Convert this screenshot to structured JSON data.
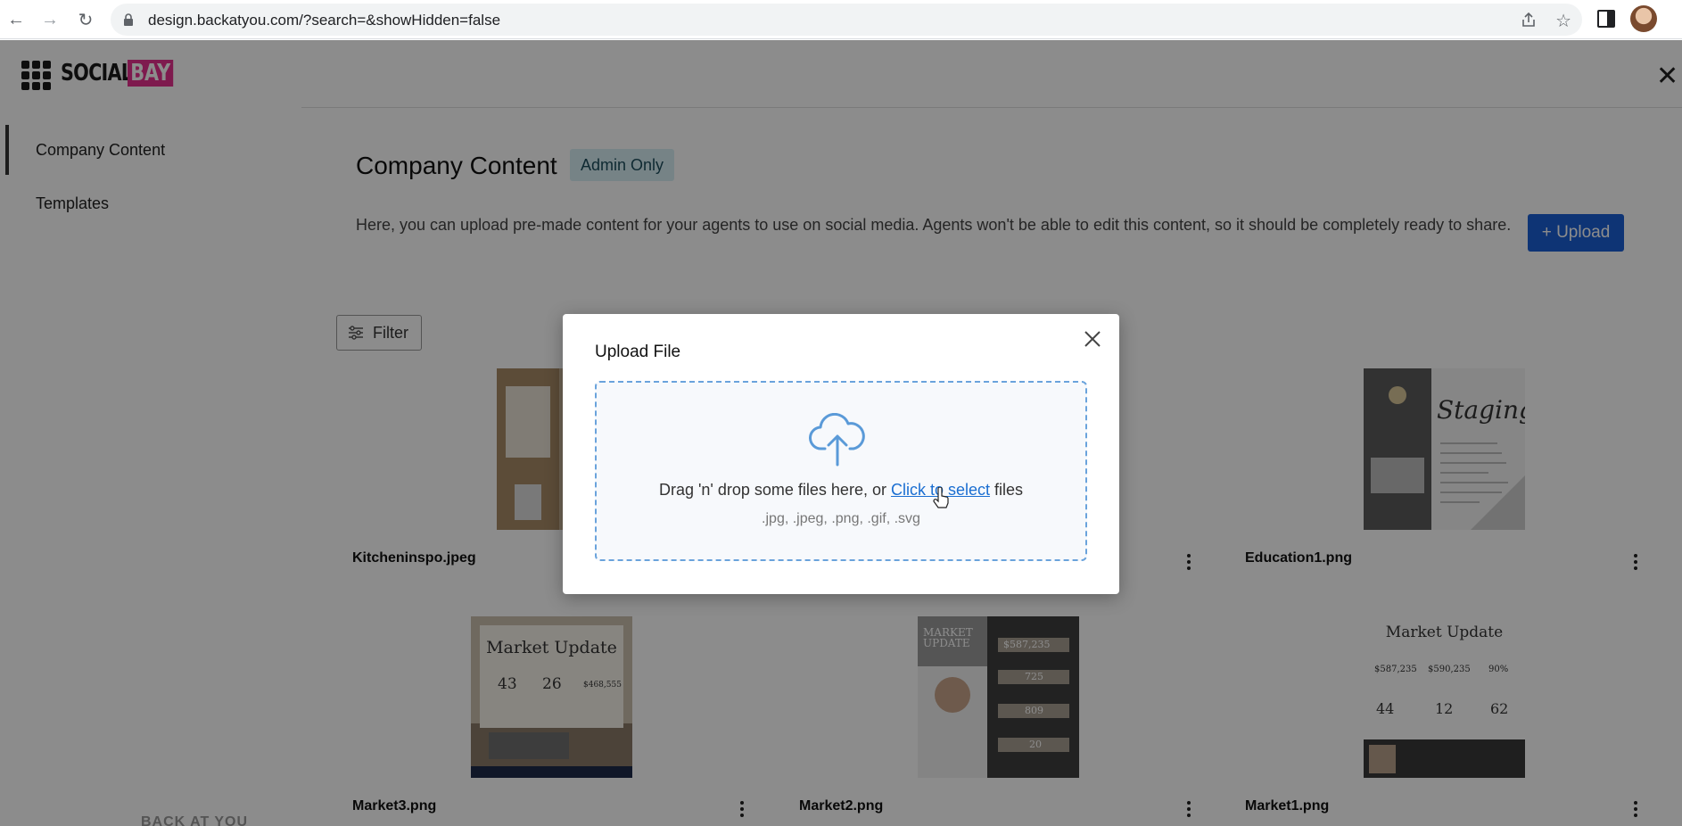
{
  "browser": {
    "url": "design.backatyou.com/?search=&showHidden=false"
  },
  "brand": {
    "word1": "SOCIAL",
    "word2": "BAY",
    "accent": "#e6318f"
  },
  "sidebar": {
    "items": [
      {
        "label": "Company Content",
        "active": true
      },
      {
        "label": "Templates",
        "active": false
      }
    ],
    "footer_logo": "BACK AT YOU"
  },
  "main": {
    "title": "Company Content",
    "badge": "Admin Only",
    "description": "Here, you can upload pre-made content for your agents to use on social media. Agents won't be able to edit this content, so it should be completely ready to share.",
    "upload_button": "+ Upload",
    "filter_button": "Filter",
    "cards": [
      {
        "name": "Kitcheninspo.jpeg"
      },
      {
        "name": ""
      },
      {
        "name": "Education1.png",
        "thumb_title": "Staging"
      },
      {
        "name": "Market3.png",
        "thumb_title": "Market Update",
        "thumb_stats": [
          "43",
          "26",
          "$468,555"
        ]
      },
      {
        "name": "Market2.png",
        "thumb_title": "MARKET UPDATE",
        "thumb_stats": [
          "$587,235",
          "725",
          "809",
          "20"
        ]
      },
      {
        "name": "Market1.png",
        "thumb_title": "Market Update",
        "thumb_stats": [
          "$587,235",
          "$590,235",
          "90%",
          "44",
          "12",
          "62"
        ]
      }
    ]
  },
  "modal": {
    "title": "Upload File",
    "drop_prefix": "Drag 'n' drop some files here, or ",
    "drop_link": "Click to select",
    "drop_suffix": " files",
    "file_types": ".jpg, .jpeg, .png, .gif, .svg"
  },
  "colors": {
    "primary": "#1a5fd6",
    "badge_bg": "#d8eef5",
    "dropzone_border": "#6aa3dc"
  }
}
